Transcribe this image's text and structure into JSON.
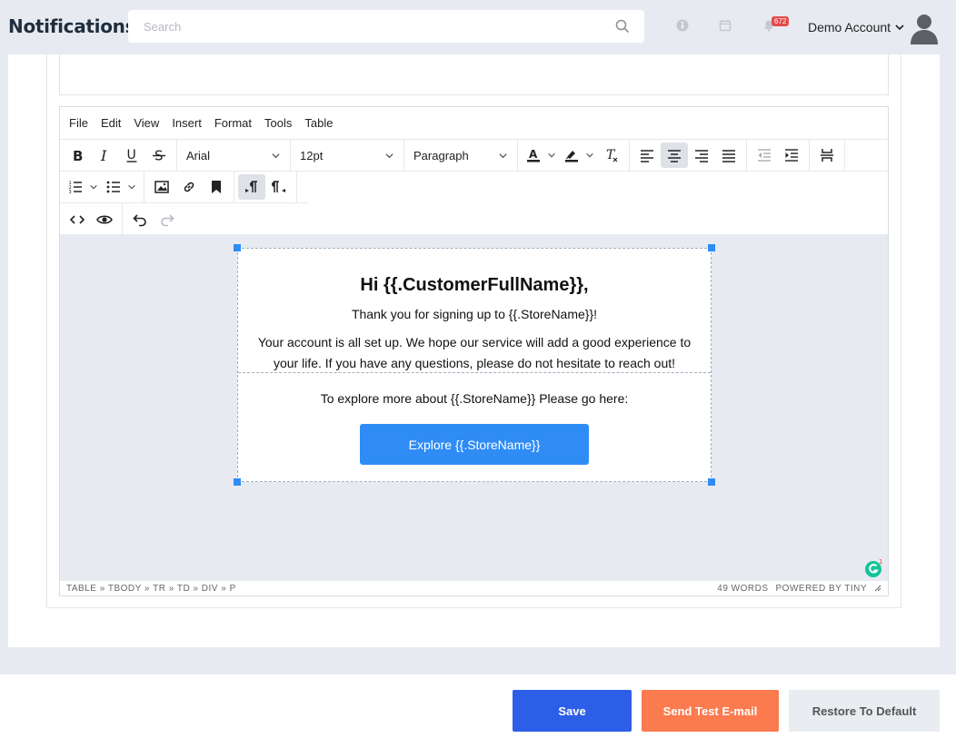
{
  "header": {
    "title": "Notifications",
    "search_placeholder": "Search",
    "notification_count": "672",
    "account_label": "Demo Account"
  },
  "editor": {
    "menu": [
      "File",
      "Edit",
      "View",
      "Insert",
      "Format",
      "Tools",
      "Table"
    ],
    "font_family": "Arial",
    "font_size": "12pt",
    "block_format": "Paragraph",
    "active_alignment": "center",
    "statusbar": {
      "path": "TABLE » TBODY » TR » TD » DIV » P",
      "word_count": "49 WORDS",
      "powered_by": "POWERED BY TINY"
    }
  },
  "email": {
    "greeting": "Hi {{.CustomerFullName}},",
    "thanks": "Thank you for signing up to {{.StoreName}}!",
    "body": "Your account is all set up. We hope our service will add a good experience to your life. If you have any questions, please do not hesitate to reach out!",
    "explore_text": "To explore more about {{.StoreName}} Please go here:",
    "button_label": "Explore {{.StoreName}}",
    "button_color": "#2f8cf5"
  },
  "grammarly_count": "1",
  "footer": {
    "save_label": "Save",
    "test_label": "Send Test E-mail",
    "restore_label": "Restore To Default"
  },
  "colors": {
    "primary": "#2d5ee8",
    "accent": "#fb7a4e",
    "badge": "#e24b4b"
  }
}
